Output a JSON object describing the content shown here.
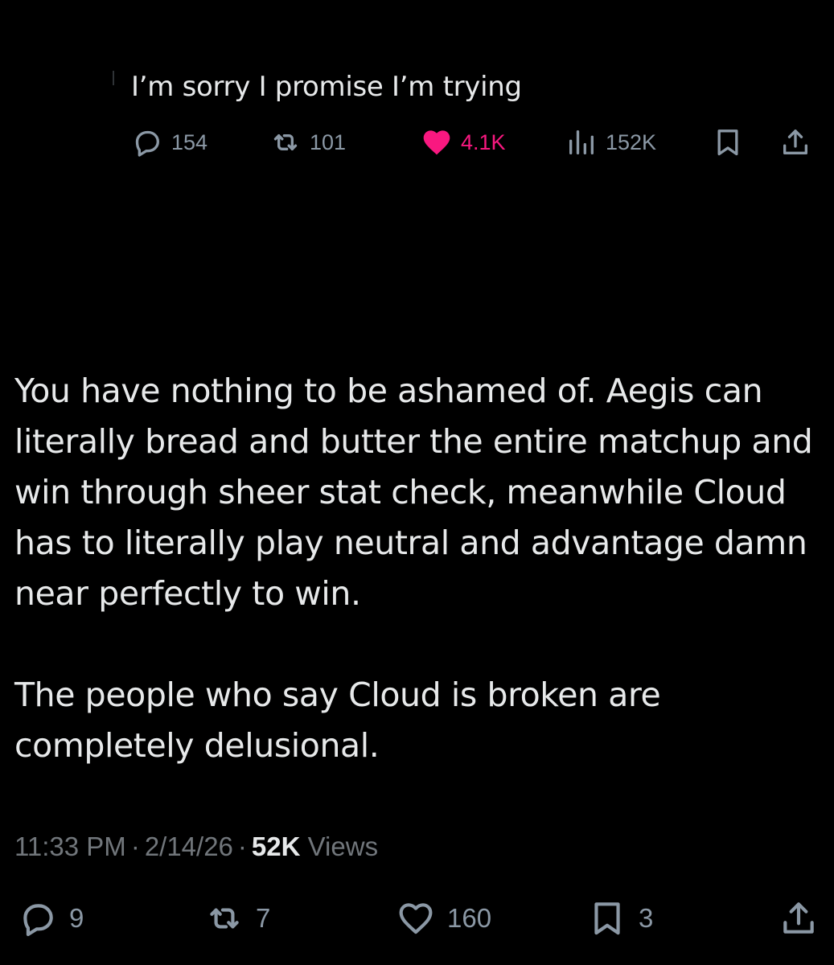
{
  "parent_tweet": {
    "text": "I’m sorry I promise I’m trying",
    "actions": {
      "reply": {
        "icon": "reply-icon",
        "count": "154"
      },
      "repost": {
        "icon": "repost-icon",
        "count": "101"
      },
      "like": {
        "icon": "heart-filled-icon",
        "count": "4.1K",
        "active": true,
        "color": "#f91880"
      },
      "views": {
        "icon": "analytics-icon",
        "count": "152K"
      },
      "bookmark": {
        "icon": "bookmark-icon"
      },
      "share": {
        "icon": "share-icon"
      }
    }
  },
  "tweet": {
    "paragraphs": [
      "You have nothing to be ashamed of. Aegis can literally bread and butter the entire matchup and win through sheer stat check, meanwhile Cloud has to literally play neutral and advantage damn near perfectly to win.",
      "The people who say Cloud is broken are completely delusional."
    ],
    "time": "11:33 PM",
    "date": "2/14/26",
    "separator": "·",
    "views_count": "52K",
    "views_label": "Views",
    "actions": {
      "reply": {
        "icon": "reply-icon",
        "count": "9"
      },
      "repost": {
        "icon": "repost-icon",
        "count": "7"
      },
      "like": {
        "icon": "heart-outline-icon",
        "count": "160"
      },
      "bookmark": {
        "icon": "bookmark-icon",
        "count": "3"
      },
      "share": {
        "icon": "share-icon"
      }
    }
  },
  "colors": {
    "background": "#000000",
    "text": "#e7e9ea",
    "secondary": "#71767b",
    "icon": "#8b98a5",
    "like": "#f91880"
  }
}
